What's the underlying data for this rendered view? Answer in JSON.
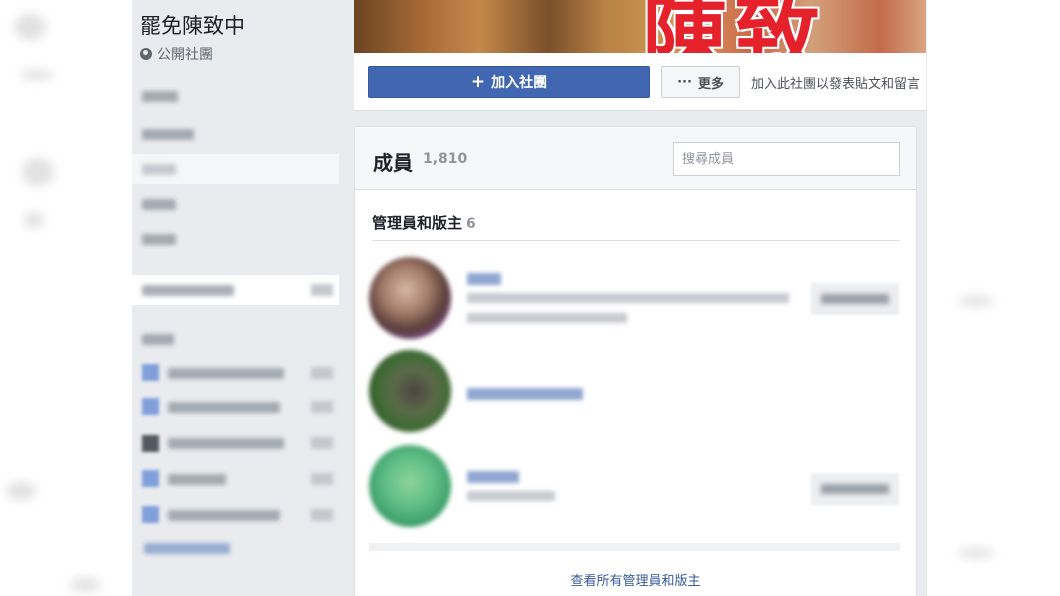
{
  "colors": {
    "brand_blue": "#4267b2",
    "link_blue": "#365899",
    "page_bg": "#e9ebee",
    "text_dark": "#1d2129",
    "text_muted": "#90949c"
  },
  "sidebar": {
    "group_name": "罷免陳致中",
    "privacy_label": "公開社團",
    "privacy_icon": "globe-icon"
  },
  "cover": {
    "text": "陳致"
  },
  "actions": {
    "join_label": "加入社團",
    "join_icon": "plus-icon",
    "more_label": "更多",
    "more_icon": "ellipsis-icon",
    "join_hint": "加入此社團以發表貼文和留言"
  },
  "members": {
    "title": "成員",
    "count": "1,810",
    "search_placeholder": "搜尋成員",
    "admins_section_title": "管理員和版主",
    "admins_count": "6",
    "see_all_link": "查看所有管理員和版主"
  }
}
